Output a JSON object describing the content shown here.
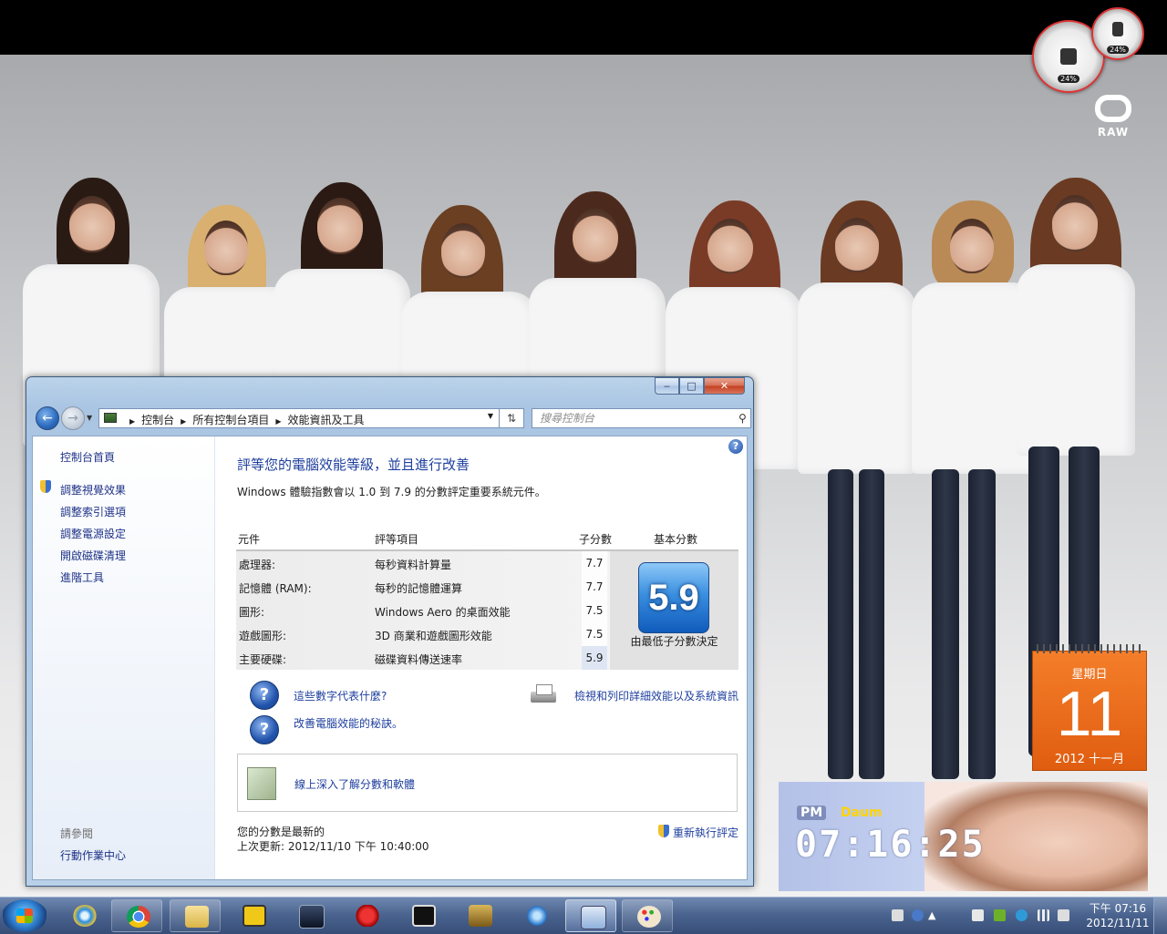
{
  "desktop": {
    "gadgets": {
      "cpu_meter": {
        "cpu": "24%",
        "ram": "24%"
      },
      "brand": "RAW",
      "calendar": {
        "weekday": "星期日",
        "day": "11",
        "year_month": "2012 十一月"
      },
      "clock": {
        "ampm": "PM",
        "brand": "Daum",
        "time": "07:16:25"
      }
    }
  },
  "window": {
    "controls": {
      "min": "‒",
      "max": "□",
      "close": "✕"
    },
    "address": {
      "crumbs": [
        "控制台",
        "所有控制台項目",
        "效能資訊及工具"
      ],
      "dropdown": "▾"
    },
    "search": {
      "placeholder": "搜尋控制台",
      "icon": "search-icon"
    },
    "sidebar": {
      "home": "控制台首頁",
      "tasks": [
        "調整視覺效果",
        "調整索引選項",
        "調整電源設定",
        "開啟磁碟清理",
        "進階工具"
      ],
      "see_also_title": "請參閱",
      "see_also": [
        "行動作業中心"
      ]
    },
    "main": {
      "heading": "評等您的電腦效能等級，並且進行改善",
      "description": "Windows 體驗指數會以 1.0 到 7.9 的分數評定重要系統元件。",
      "table": {
        "headers": [
          "元件",
          "評等項目",
          "子分數",
          "基本分數"
        ],
        "rows": [
          {
            "component": "處理器:",
            "item": "每秒資料計算量",
            "score": "7.7"
          },
          {
            "component": "記憶體 (RAM):",
            "item": "每秒的記憶體運算",
            "score": "7.7"
          },
          {
            "component": "圖形:",
            "item": "Windows Aero 的桌面效能",
            "score": "7.5"
          },
          {
            "component": "遊戲圖形:",
            "item": "3D 商業和遊戲圖形效能",
            "score": "7.5"
          },
          {
            "component": "主要硬碟:",
            "item": "磁碟資料傳送速率",
            "score": "5.9"
          }
        ],
        "base_score": "5.9",
        "base_caption": "由最低子分數決定"
      },
      "links": {
        "what_numbers": "這些數字代表什麼?",
        "tips": "改善電腦效能的秘訣。",
        "print": "檢視和列印詳細效能以及系統資訊",
        "online": "線上深入了解分數和軟體"
      },
      "status": {
        "current": "您的分數是最新的",
        "last_update": "上次更新: 2012/11/10 下午 10:40:00",
        "rerun": "重新執行評定"
      }
    }
  },
  "taskbar": {
    "apps": [
      "internet-explorer",
      "chrome",
      "explorer",
      "app-yellow",
      "kmplayer",
      "game-2",
      "media-player",
      "lol",
      "app-arrow",
      "performance-info",
      "paint"
    ],
    "clock": {
      "time": "下午 07:16",
      "date": "2012/11/11"
    }
  }
}
